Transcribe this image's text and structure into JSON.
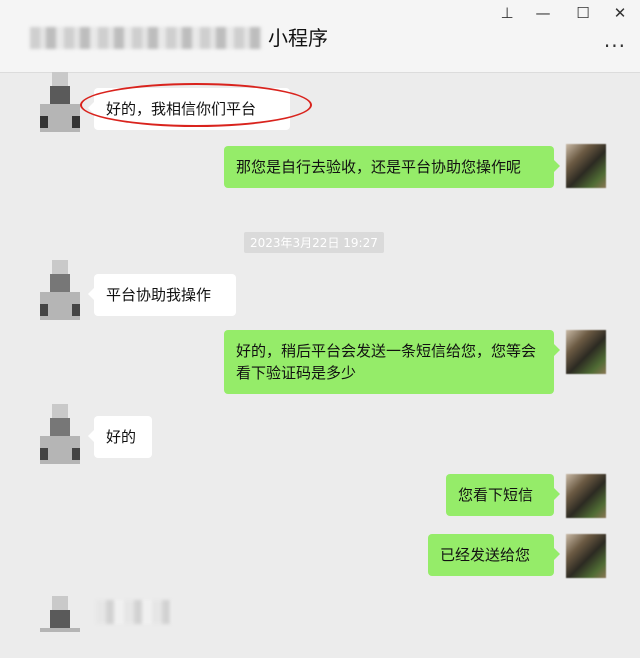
{
  "window": {
    "title": "小程序",
    "pin_glyph": "⊥",
    "minimize_glyph": "—",
    "maximize_glyph": "☐",
    "close_glyph": "✕",
    "more_glyph": "···"
  },
  "timestamp": "2023年3月22日 19:27",
  "messages": [
    {
      "side": "left",
      "text": "好的，我相信你们平台",
      "highlighted": true
    },
    {
      "side": "right",
      "text": "那您是自行去验收，还是平台协助您操作呢"
    },
    {
      "side": "left",
      "text": "平台协助我操作"
    },
    {
      "side": "right",
      "text": "好的，稍后平台会发送一条短信给您，您等会看下验证码是多少"
    },
    {
      "side": "left",
      "text": "好的"
    },
    {
      "side": "right",
      "text": "您看下短信"
    },
    {
      "side": "right",
      "text": "已经发送给您"
    }
  ],
  "colors": {
    "bubble_self": "#95ec69",
    "bubble_other": "#ffffff",
    "background": "#ececec",
    "annotation": "#d9231d"
  }
}
